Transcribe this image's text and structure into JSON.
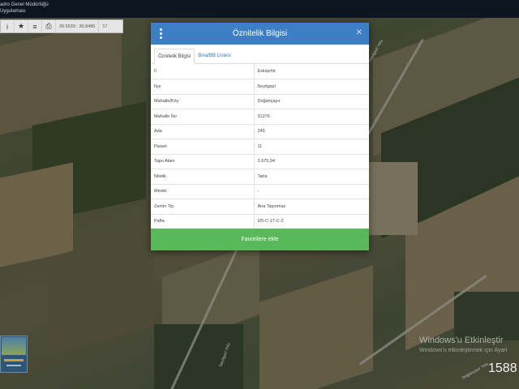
{
  "header": {
    "line1": "adro Genel Müdürlüğü",
    "line2": "Uygulaması"
  },
  "toolbar": {
    "info_icon": "info-icon",
    "star_icon": "star-icon",
    "print_icon": "print-icon",
    "coordinates": "39.5639 : 30.8486",
    "zoom": "17"
  },
  "modal": {
    "title": "Öznitelik Bilgisi",
    "tabs": [
      {
        "label": "Öznitelik Bilgisi",
        "active": true
      },
      {
        "label": "Bina/BB Listesi",
        "active": false
      }
    ],
    "rows": [
      {
        "key": "İl",
        "value": "Eskişehir"
      },
      {
        "key": "İlçe",
        "value": "Seyitgazi"
      },
      {
        "key": "Mahalle/Köy",
        "value": "Doğançayır"
      },
      {
        "key": "Mahalle No",
        "value": "31276"
      },
      {
        "key": "Ada",
        "value": "245"
      },
      {
        "key": "Parsel",
        "value": "11"
      },
      {
        "key": "Tapu Alanı",
        "value": "3.675,94"
      },
      {
        "key": "Nitelik",
        "value": "Tarla"
      },
      {
        "key": "Mevkii",
        "value": "-"
      },
      {
        "key": "Zemin Tip",
        "value": "Ana Taşınmaz"
      },
      {
        "key": "Pafta",
        "value": "I25-C-17-C-2"
      }
    ],
    "favorite_button": "Favorilere ekle"
  },
  "map": {
    "road_label_1": "Seyitgazi Yolu",
    "road_label_2": "Seyitgazi Yolu",
    "road_label_3": "Doğançayır Yolu"
  },
  "watermark": {
    "title": "Windows'u Etkinleştir",
    "subtitle": "Windows'u etkinleştirmek için Ayarl",
    "counter": "1588"
  },
  "colors": {
    "header_blue": "#3c7fc4",
    "button_green": "#58b85a",
    "topbar": "#0d1520"
  }
}
